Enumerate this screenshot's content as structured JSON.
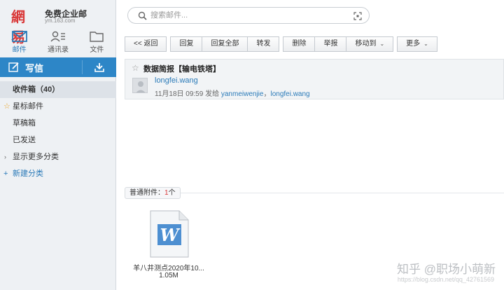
{
  "logo": {
    "mark": "網易",
    "title": "免费企业邮",
    "domain": "ym.163.com"
  },
  "nav_tabs": [
    {
      "label": "邮件",
      "icon": "mail-icon",
      "active": true
    },
    {
      "label": "通讯录",
      "icon": "contacts-icon",
      "active": false
    },
    {
      "label": "文件",
      "icon": "folder-icon",
      "active": false
    }
  ],
  "compose": {
    "label": "写信"
  },
  "folders": {
    "inbox": "收件箱（40）",
    "starred": "星标邮件",
    "drafts": "草稿箱",
    "sent": "已发送",
    "more": "显示更多分类",
    "new": "新建分类"
  },
  "search": {
    "placeholder": "搜索邮件..."
  },
  "toolbar": {
    "back": "<< 返回",
    "reply": "回复",
    "reply_all": "回复全部",
    "forward": "转发",
    "delete": "删除",
    "report": "举报",
    "move_to": "移动到",
    "more": "更多"
  },
  "message": {
    "subject": "数据简报【输电铁塔】",
    "sender": "longfei.wang",
    "date": "11月18日 09:59",
    "sent_to_label": "发给",
    "recipients": [
      "yanmeiwenjie",
      "longfei.wang"
    ],
    "recipient_sep": "，"
  },
  "attachments": {
    "label": "普通附件：",
    "count": "1",
    "unit": "个",
    "files": [
      {
        "name": "羊八井测点2020年10...",
        "size": "1.05M",
        "icon": "word-document-icon"
      }
    ]
  },
  "watermark": {
    "text": "知乎 @职场小萌新",
    "url": "https://blog.csdn.net/qq_42761569"
  },
  "colors": {
    "accent": "#2d86c7",
    "link": "#2a7ab8",
    "brand_red": "#d93a3a",
    "star": "#e9a325"
  }
}
